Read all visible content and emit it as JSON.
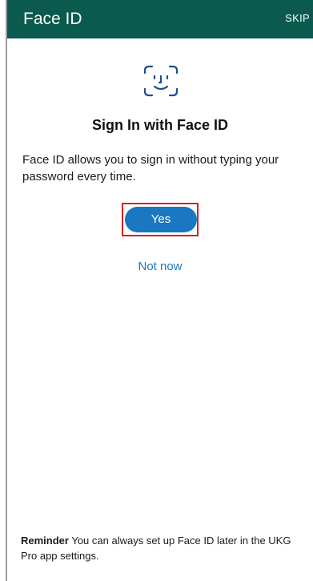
{
  "header": {
    "title": "Face ID",
    "skip_label": "SKIP"
  },
  "main": {
    "icon": "face-id-icon",
    "title": "Sign In with Face ID",
    "description": "Face ID allows you to sign in without typing your password every time.",
    "yes_label": "Yes",
    "not_now_label": "Not now"
  },
  "footer": {
    "reminder_label": "Reminder",
    "reminder_text": " You can always set up Face ID later in the UKG Pro app settings."
  },
  "colors": {
    "header_background": "#0a5a4d",
    "accent": "#1a78c2",
    "highlight_outline": "#d92020"
  }
}
